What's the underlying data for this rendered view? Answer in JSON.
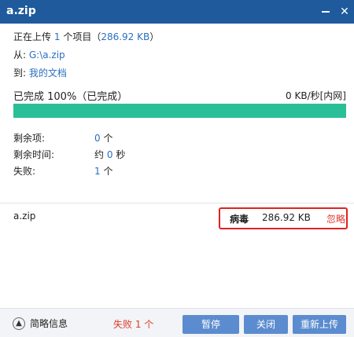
{
  "window": {
    "title": "a.zip",
    "minimize_glyph": "minimize-icon",
    "close_glyph": "close-icon"
  },
  "info": {
    "uploading_prefix": "正在上传",
    "count": "1",
    "item_text": "个项目（",
    "size": "286.92 KB",
    "close_paren": "）",
    "from_label": "从:",
    "from_path": "G:\\a.zip",
    "to_label": "到:",
    "to_path": "我的文档"
  },
  "progress": {
    "status": "已完成 100%（已完成）",
    "percent": 100,
    "speed": "0 KB/秒",
    "network": "[内网]"
  },
  "stats": {
    "remaining_items_label": "剩余项:",
    "remaining_items_value": "0",
    "remaining_items_unit": "个",
    "remaining_time_label": "剩余时间:",
    "remaining_time_prefix": "约",
    "remaining_time_value": "0",
    "remaining_time_unit": "秒",
    "failed_label": "失败:",
    "failed_value": "1",
    "failed_unit": "个"
  },
  "file": {
    "name": "a.zip",
    "status": "病毒",
    "size": "286.92 KB",
    "action": "忽略"
  },
  "footer": {
    "summary_label": "简略信息",
    "fail_summary": "失败 1 个",
    "pause_label": "暂停",
    "close_label": "关闭",
    "reupload_label": "重新上传"
  },
  "colors": {
    "titlebar": "#1e5a9c",
    "progress": "#2bbf97",
    "link": "#2a6fc0",
    "alert": "#e03a2f",
    "button": "#5b8ccf"
  }
}
